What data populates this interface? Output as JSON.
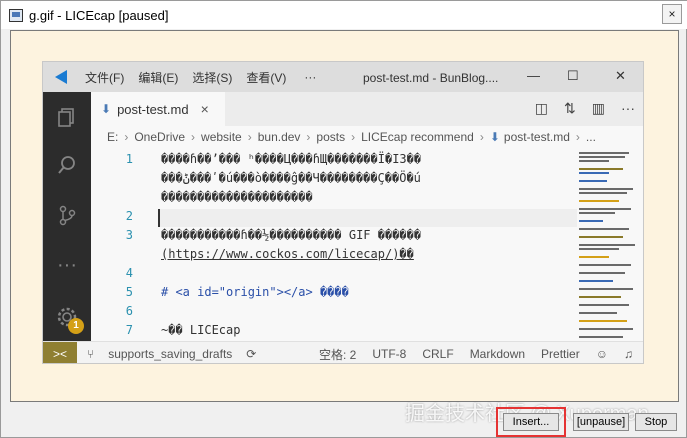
{
  "outer_window": {
    "title": "g.gif - LICEcap [paused]",
    "close_label": "×",
    "buttons": {
      "insert": "Insert...",
      "unpause": "[unpause]",
      "stop": "Stop"
    },
    "watermark": "掘金技术社区 @ Xuperman"
  },
  "vscode": {
    "menu": [
      "文件(F)",
      "编辑(E)",
      "选择(S)",
      "查看(V)"
    ],
    "menu_more": "···",
    "doc_title": "post-test.md - BunBlog....",
    "window_buttons": {
      "minimize": "—",
      "maximize": "☐",
      "close": "✕"
    },
    "tab": {
      "label": "post-test.md",
      "close": "×"
    },
    "breadcrumb": [
      "E:",
      "OneDrive",
      "website",
      "bun.dev",
      "posts",
      "LICEcap recommend",
      "post-test.md",
      "..."
    ],
    "breadcrumb_sep": "›",
    "activity_badge": "1",
    "line_numbers": [
      "1",
      "2",
      "3",
      "4",
      "5",
      "6",
      "7"
    ],
    "code_lines": {
      "l1a": "����ɦ��’��� ʰ����Ц���ɦЩ�������Ϊ�Ι3��",
      "l1b": "���ݨ���ʹ�ú���ò����ĝ��Ч��������Ç��Ö�ú",
      "l1c": "���������������������",
      "l3a": "�����������ɦ��½���������� GIF ������",
      "l3b": "(https://www.cockos.com/licecap/)��",
      "l5": "# <a id=\"origin\"></a> ����",
      "l7": "~�� LICEcap"
    },
    "status": {
      "remote": "><",
      "branch": "supports_saving_drafts",
      "spaces": "空格: 2",
      "encoding": "UTF-8",
      "eol": "CRLF",
      "language": "Markdown",
      "formatter": "Prettier"
    },
    "colors": {
      "accent": "#1a7bd2",
      "remote_bg": "#8f7f32",
      "highlight": "#e53333"
    }
  }
}
